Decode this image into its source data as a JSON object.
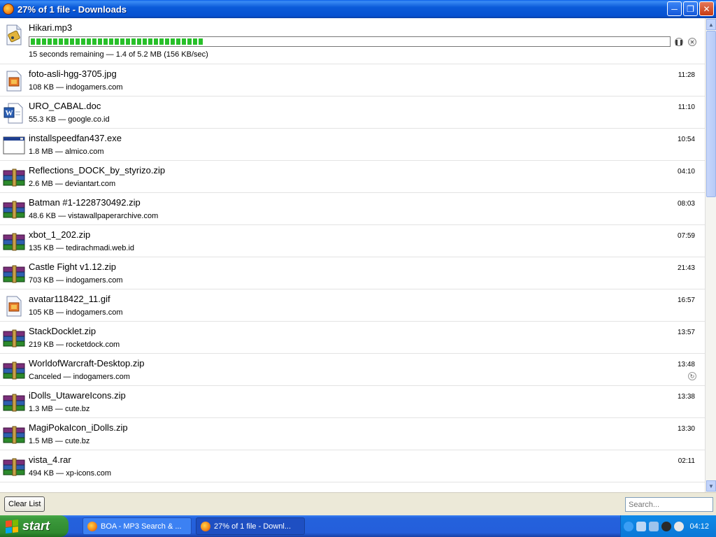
{
  "window": {
    "title": "27% of 1 file - Downloads"
  },
  "active_download": {
    "name": "Hikari.mp3",
    "status": "15 seconds remaining — 1.4 of 5.2 MB (156 KB/sec)",
    "progress_percent": 27
  },
  "downloads": [
    {
      "name": "foto-asli-hgg-3705.jpg",
      "meta": "108 KB — indogamers.com",
      "time": "11:28",
      "icon": "image-file-icon"
    },
    {
      "name": "URO_CABAL.doc",
      "meta": "55.3 KB — google.co.id",
      "time": "11:10",
      "icon": "word-document-icon"
    },
    {
      "name": "installspeedfan437.exe",
      "meta": "1.8 MB — almico.com",
      "time": "10:54",
      "icon": "executable-icon"
    },
    {
      "name": "Reflections_DOCK_by_styrizo.zip",
      "meta": "2.6 MB — deviantart.com",
      "time": "04:10",
      "icon": "archive-icon"
    },
    {
      "name": "Batman #1-1228730492.zip",
      "meta": "48.6 KB — vistawallpaperarchive.com",
      "time": "08:03",
      "icon": "archive-icon"
    },
    {
      "name": "xbot_1_202.zip",
      "meta": "135 KB — tedirachmadi.web.id",
      "time": "07:59",
      "icon": "archive-icon"
    },
    {
      "name": "Castle Fight v1.12.zip",
      "meta": "703 KB — indogamers.com",
      "time": "21:43",
      "icon": "archive-icon"
    },
    {
      "name": "avatar118422_11.gif",
      "meta": "105 KB — indogamers.com",
      "time": "16:57",
      "icon": "image-file-icon"
    },
    {
      "name": "StackDocklet.zip",
      "meta": "219 KB — rocketdock.com",
      "time": "13:57",
      "icon": "archive-icon"
    },
    {
      "name": "WorldofWarcraft-Desktop.zip",
      "meta": "Canceled — indogamers.com",
      "time": "13:48",
      "icon": "archive-icon",
      "canceled": true
    },
    {
      "name": "iDolls_UtawareIcons.zip",
      "meta": "1.3 MB — cute.bz",
      "time": "13:38",
      "icon": "archive-icon"
    },
    {
      "name": "MagiPokaIcon_iDolls.zip",
      "meta": "1.5 MB — cute.bz",
      "time": "13:30",
      "icon": "archive-icon"
    },
    {
      "name": "vista_4.rar",
      "meta": "494 KB — xp-icons.com",
      "time": "02:11",
      "icon": "archive-icon"
    }
  ],
  "footer": {
    "clear_label": "Clear List",
    "search_placeholder": "Search..."
  },
  "taskbar": {
    "start_label": "start",
    "tasks": [
      {
        "label": "BOA - MP3 Search & ..."
      },
      {
        "label": "27% of 1 file - Downl..."
      }
    ],
    "clock": "04:12"
  }
}
